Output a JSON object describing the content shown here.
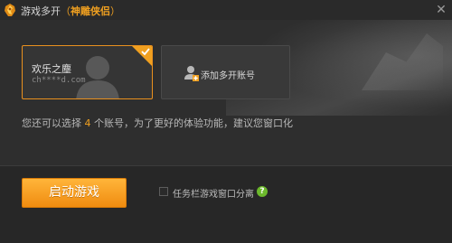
{
  "window": {
    "title_prefix": "游戏多开",
    "title_open": "（",
    "game_name": "神雕侠侣",
    "title_close": "）",
    "close_glyph": "✕"
  },
  "accounts": [
    {
      "name": "欢乐之塵",
      "email": "ch****d.com",
      "selected": true
    }
  ],
  "add_account": {
    "label": "添加多开账号"
  },
  "info": {
    "prefix": "您还可以选择",
    "count": "4",
    "suffix": "个账号，为了更好的体验功能，建议您窗口化"
  },
  "footer": {
    "start_label": "启动游戏",
    "separate_label": "任务栏游戏窗口分离",
    "help_glyph": "?"
  },
  "colors": {
    "accent": "#f0a020",
    "button_top": "#ffb53a",
    "button_bottom": "#f08c10",
    "help": "#6cb92c",
    "background": "#2e2e2e"
  }
}
